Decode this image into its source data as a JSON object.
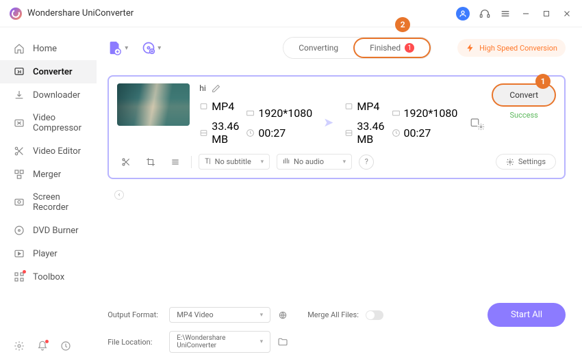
{
  "app": {
    "title": "Wondershare UniConverter"
  },
  "sidebar": {
    "items": [
      {
        "label": "Home",
        "icon": "home"
      },
      {
        "label": "Converter",
        "icon": "convert",
        "active": true
      },
      {
        "label": "Downloader",
        "icon": "download"
      },
      {
        "label": "Video Compressor",
        "icon": "compress"
      },
      {
        "label": "Video Editor",
        "icon": "scissors"
      },
      {
        "label": "Merger",
        "icon": "merge"
      },
      {
        "label": "Screen Recorder",
        "icon": "record"
      },
      {
        "label": "DVD Burner",
        "icon": "disc"
      },
      {
        "label": "Player",
        "icon": "play"
      },
      {
        "label": "Toolbox",
        "icon": "grid"
      }
    ]
  },
  "tabs": {
    "converting": "Converting",
    "finished": "Finished",
    "finished_count": "1"
  },
  "high_speed": "High Speed Conversion",
  "callouts": {
    "one": "1",
    "two": "2"
  },
  "card": {
    "name": "hi",
    "src": {
      "fmt": "MP4",
      "res": "1920*1080",
      "size": "33.46 MB",
      "dur": "00:27"
    },
    "dst": {
      "fmt": "MP4",
      "res": "1920*1080",
      "size": "33.46 MB",
      "dur": "00:27"
    },
    "subtitle_sel": "No subtitle",
    "audio_sel": "No audio",
    "settings": "Settings",
    "convert": "Convert",
    "status": "Success"
  },
  "footer": {
    "output_label": "Output Format:",
    "output_value": "MP4 Video",
    "merge_label": "Merge All Files:",
    "location_label": "File Location:",
    "location_value": "E:\\Wondershare UniConverter",
    "start_all": "Start All"
  }
}
